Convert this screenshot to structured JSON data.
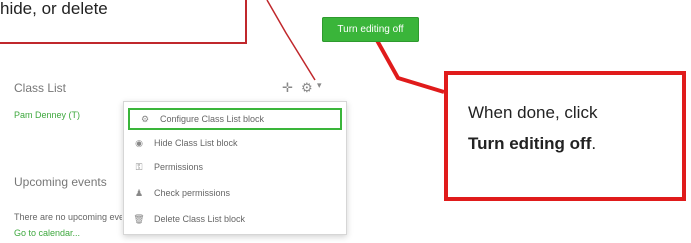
{
  "callouts": {
    "top_left_text": "hide, or delete",
    "right_line1": "When done, click",
    "right_line2_bold": "Turn editing off",
    "right_line2_tail": "."
  },
  "toolbar": {
    "turn_editing_label": "Turn editing off"
  },
  "class_list": {
    "title": "Class List",
    "student": "Pam Denney (T)"
  },
  "action_menu": {
    "items": [
      {
        "label": "Configure Class List block",
        "icon": "gear-icon"
      },
      {
        "label": "Hide Class List block",
        "icon": "eye-icon"
      },
      {
        "label": "Permissions",
        "icon": "key-icon"
      },
      {
        "label": "Check permissions",
        "icon": "user-icon"
      },
      {
        "label": "Delete Class List block",
        "icon": "trash-icon"
      }
    ]
  },
  "upcoming": {
    "title": "Upcoming events",
    "empty_text": "There are no upcoming events",
    "calendar_link": "Go to calendar..."
  },
  "colors": {
    "accent_green": "#3ab53a",
    "callout_red": "#e01b1b"
  }
}
